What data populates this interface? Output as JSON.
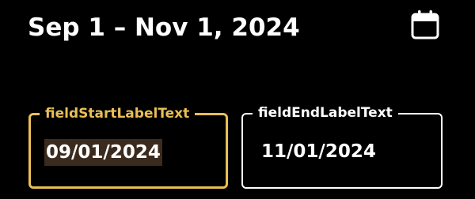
{
  "header": {
    "title": "Sep 1 – Nov 1, 2024",
    "calendar_icon": "calendar-icon"
  },
  "fields": {
    "start": {
      "label": "fieldStartLabelText",
      "value": "09/01/2024",
      "focused": true
    },
    "end": {
      "label": "fieldEndLabelText",
      "value": "11/01/2024",
      "focused": false
    }
  },
  "colors": {
    "background": "#000000",
    "accent": "#e9bf54",
    "text": "#ffffff",
    "selection": "#3b2b1f"
  }
}
